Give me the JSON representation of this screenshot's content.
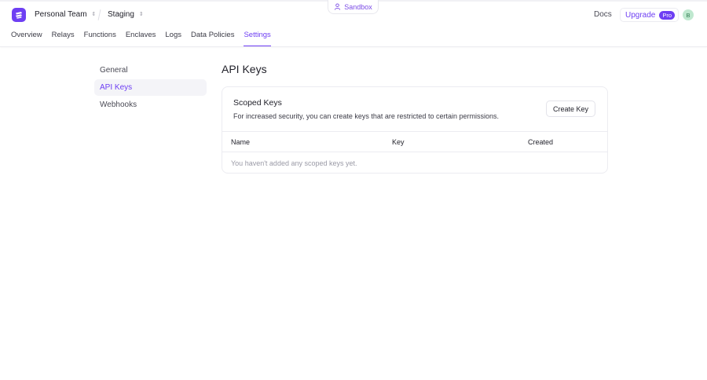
{
  "header": {
    "team": "Personal Team",
    "environment": "Staging",
    "sandbox_label": "Sandbox",
    "docs": "Docs",
    "upgrade": "Upgrade",
    "plan_badge": "Pro",
    "avatar_initial": "B"
  },
  "nav": {
    "items": [
      "Overview",
      "Relays",
      "Functions",
      "Enclaves",
      "Logs",
      "Data Policies",
      "Settings"
    ],
    "active": "Settings"
  },
  "sidebar": {
    "items": [
      "General",
      "API Keys",
      "Webhooks"
    ],
    "active": "API Keys"
  },
  "page": {
    "title": "API Keys"
  },
  "scoped_keys": {
    "title": "Scoped Keys",
    "description": "For increased security, you can create keys that are restricted to certain permissions.",
    "create_button": "Create Key",
    "columns": [
      "Name",
      "Key",
      "Created"
    ],
    "empty_message": "You haven't added any scoped keys yet."
  },
  "colors": {
    "accent": "#6e3ff3",
    "avatar_bg": "#bfe8cf"
  }
}
